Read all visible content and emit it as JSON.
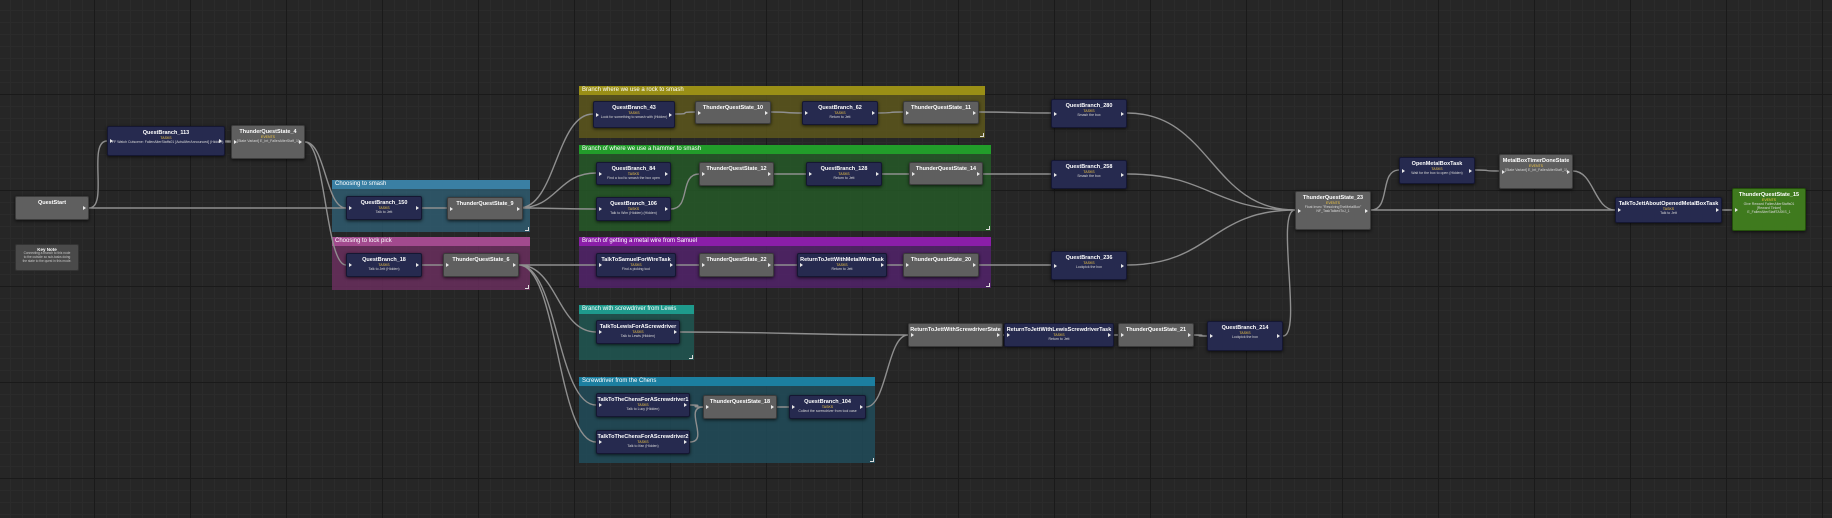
{
  "groups": [
    {
      "title": "Choosing to smash",
      "color": "#2f5f74",
      "header": "#3a7fa3"
    },
    {
      "title": "Choosing to lock pick",
      "color": "#6e2f61",
      "header": "#a24a8e"
    },
    {
      "title": "Branch where we use a rock to smash",
      "color": "#605a1c",
      "header": "#9a8f16"
    },
    {
      "title": "Branch of where we use a hammer to smash",
      "color": "#265c28",
      "header": "#229c2a"
    },
    {
      "title": "Branch of getting a metal wire from Samuel",
      "color": "#55236f",
      "header": "#8a1ea8"
    },
    {
      "title": "Branch with screwdriver from Lewis",
      "color": "#1f5a55",
      "header": "#1e9a8c"
    },
    {
      "title": "Screwdriver from the Chens",
      "color": "#214f5e",
      "header": "#1c7fa0"
    }
  ],
  "nodes": {
    "quest_start": {
      "title": "QuestStart"
    },
    "key_note": {
      "title": "Key Note",
      "desc": "Connecting a branch to this node to the outside so sub-tasks doing the state to the quest in this mode."
    },
    "qb113": {
      "title": "QuestBranch_113",
      "key": "TASKS",
      "desc": "FF Watch Cutscene: FallenAlterStaffs01 [ActsAfterAnnounced] (Hidden)"
    },
    "tqs4": {
      "title": "ThunderQuestState_4",
      "key": "EVENTS",
      "desc": "[State Variant] E_Int_FallenAlterStaff_1]"
    },
    "qb150": {
      "title": "QuestBranch_150",
      "key": "TASKS",
      "desc": "Talk to Jett"
    },
    "tqs9": {
      "title": "ThunderQuestState_9"
    },
    "qb18": {
      "title": "QuestBranch_18",
      "key": "TASKS",
      "desc": "Talk to Jett (Hidden)"
    },
    "tqs6": {
      "title": "ThunderQuestState_6"
    },
    "qb43": {
      "title": "QuestBranch_43",
      "key": "TASKS",
      "desc": "Look for something to smash with (Hidden)"
    },
    "tqs10": {
      "title": "ThunderQuestState_10"
    },
    "qb62": {
      "title": "QuestBranch_62",
      "key": "TASKS",
      "desc": "Return to Jett"
    },
    "tqs11": {
      "title": "ThunderQuestState_11"
    },
    "qb84": {
      "title": "QuestBranch_84",
      "key": "TASKS",
      "desc": "Find a tool to smash the box open"
    },
    "tqs12": {
      "title": "ThunderQuestState_12"
    },
    "qb128": {
      "title": "QuestBranch_128",
      "key": "TASKS",
      "desc": "Return to Jett"
    },
    "tqs14": {
      "title": "ThunderQuestState_14"
    },
    "qb106": {
      "title": "QuestBranch_106",
      "key": "TASKS",
      "desc": "Talk to Wim (Hidden) (Hidden)"
    },
    "tsfwt": {
      "title": "TalkToSamuelForWireTask",
      "key": "TASKS",
      "desc": "Find a picking tool"
    },
    "tqs22": {
      "title": "ThunderQuestState_22"
    },
    "rtjmwt": {
      "title": "ReturnToJettWithMetalWireTask",
      "key": "TASKS",
      "desc": "Return to Jett"
    },
    "tqs20": {
      "title": "ThunderQuestState_20"
    },
    "ttlfs": {
      "title": "TalkToLewisForAScrewdriver",
      "key": "TASKS",
      "desc": "Talk to Lewis (Hidden)"
    },
    "ttcfs1": {
      "title": "TalkToTheChensForAScrewdriver1",
      "key": "TASKS",
      "desc": "Talk to Lucy (Hidden)"
    },
    "tqs18": {
      "title": "ThunderQuestState_18"
    },
    "qb104": {
      "title": "QuestBranch_104",
      "key": "TASKS",
      "desc": "Collect the screwdriver from tool case"
    },
    "ttcfs2": {
      "title": "TalkToTheChensForAScrewdriver2",
      "key": "TASKS",
      "desc": "Talk to Ifan (Hidden)"
    },
    "rtjws": {
      "title": "ReturnToJettWithScrewdriverState"
    },
    "rtjwlst": {
      "title": "ReturnToJettWithLewisScrewdriverTask",
      "key": "TASKS",
      "desc": "Return to Jett"
    },
    "tqs21": {
      "title": "ThunderQuestState_21"
    },
    "qb214": {
      "title": "QuestBranch_214",
      "key": "TASKS",
      "desc": "Lockpick the box"
    },
    "qb280": {
      "title": "QuestBranch_280",
      "key": "TASKS",
      "desc": "Smash the box"
    },
    "qb258": {
      "title": "QuestBranch_258",
      "key": "TASKS",
      "desc": "Smash the box"
    },
    "qb236": {
      "title": "QuestBranch_236",
      "key": "TASKS",
      "desc": "Lockpick the box"
    },
    "tqs23": {
      "title": "ThunderQuestState_23",
      "key": "EVENTS",
      "desc": "Float Invec \"ResolvingTheMetalBox\" NF_TaskTalkedToJ_1"
    },
    "ombt": {
      "title": "OpenMetalBoxTask",
      "key": "TASKS",
      "desc": "Wait for the box to open (Hidden)"
    },
    "mbtds": {
      "title": "MetalBoxTimerDoneState",
      "key": "EVENTS",
      "desc": "[State Variant] E_Int_FallenAlterStaff_1]"
    },
    "ttjaomb": {
      "title": "TalkToJettAboutOpenedMetalBoxTask",
      "key": "TASKS",
      "desc": "Talk to Jett"
    },
    "tqs15": {
      "title": "ThunderQuestState_15",
      "key": "EVENTS",
      "desc": "Give Reward FallenAlterStaffs01 [Reward Tinker] E_FallenAlterStaffTASKS_1"
    }
  }
}
